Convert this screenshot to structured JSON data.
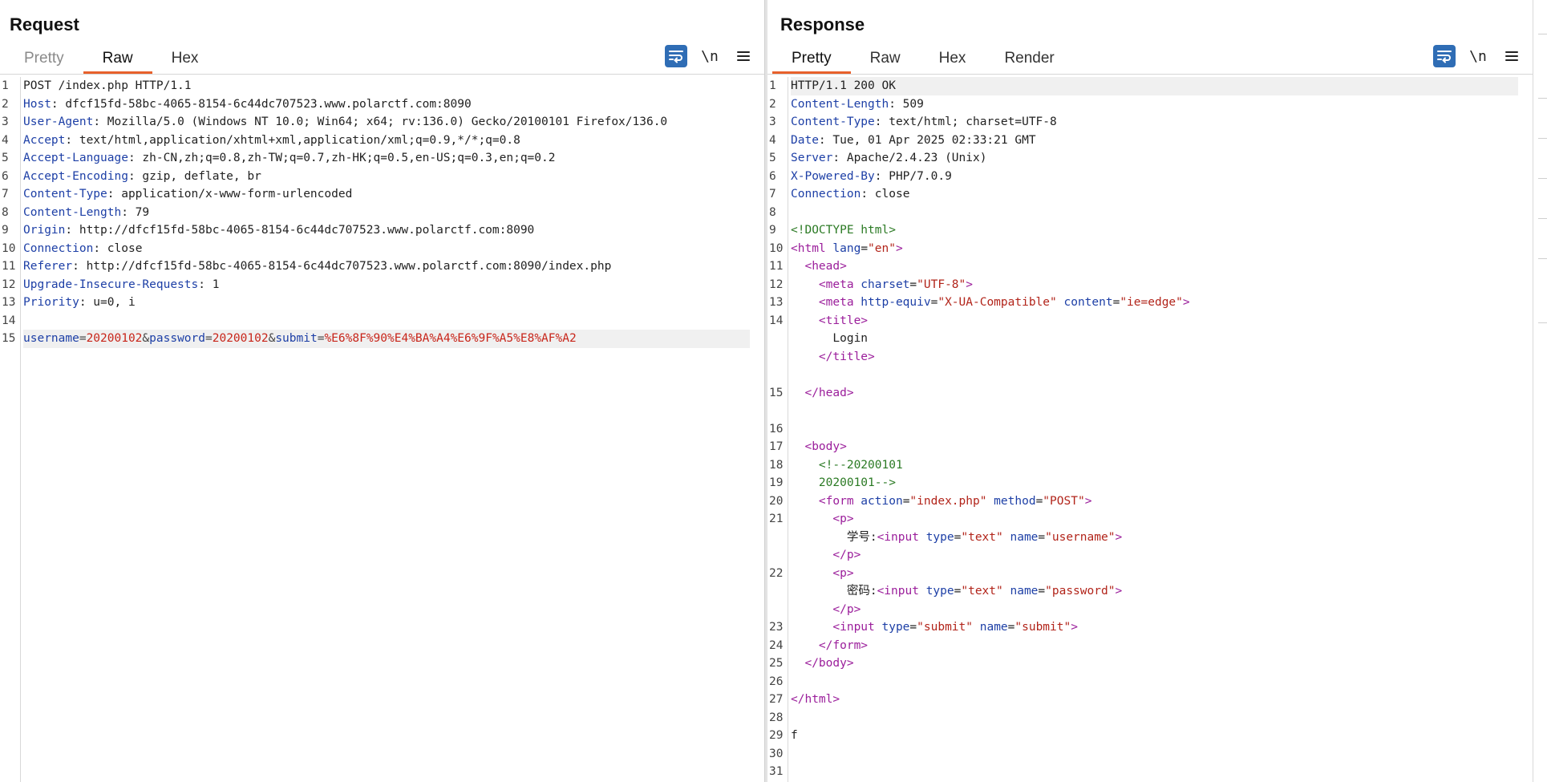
{
  "request": {
    "title": "Request",
    "tabs": [
      "Pretty",
      "Raw",
      "Hex"
    ],
    "active_tab": "Raw",
    "lines": [
      {
        "n": "1",
        "segs": [
          {
            "t": "POST /index.php HTTP/1.1",
            "c": "v"
          }
        ]
      },
      {
        "n": "2",
        "segs": [
          {
            "t": "Host",
            "c": "k"
          },
          {
            "t": ": dfcf15fd-58bc-4065-8154-6c44dc707523.www.polarctf.com:8090",
            "c": "v"
          }
        ]
      },
      {
        "n": "3",
        "segs": [
          {
            "t": "User-Agent",
            "c": "k"
          },
          {
            "t": ": Mozilla/5.0 (Windows NT 10.0; Win64; x64; rv:136.0) Gecko/20100101 Firefox/136.0",
            "c": "v"
          }
        ]
      },
      {
        "n": "4",
        "segs": [
          {
            "t": "Accept",
            "c": "k"
          },
          {
            "t": ": text/html,application/xhtml+xml,application/xml;q=0.9,*/*;q=0.8",
            "c": "v"
          }
        ]
      },
      {
        "n": "5",
        "segs": [
          {
            "t": "Accept-Language",
            "c": "k"
          },
          {
            "t": ": zh-CN,zh;q=0.8,zh-TW;q=0.7,zh-HK;q=0.5,en-US;q=0.3,en;q=0.2",
            "c": "v"
          }
        ]
      },
      {
        "n": "6",
        "segs": [
          {
            "t": "Accept-Encoding",
            "c": "k"
          },
          {
            "t": ": gzip, deflate, br",
            "c": "v"
          }
        ]
      },
      {
        "n": "7",
        "segs": [
          {
            "t": "Content-Type",
            "c": "k"
          },
          {
            "t": ": application/x-www-form-urlencoded",
            "c": "v"
          }
        ]
      },
      {
        "n": "8",
        "segs": [
          {
            "t": "Content-Length",
            "c": "k"
          },
          {
            "t": ": 79",
            "c": "v"
          }
        ]
      },
      {
        "n": "9",
        "segs": [
          {
            "t": "Origin",
            "c": "k"
          },
          {
            "t": ": http://dfcf15fd-58bc-4065-8154-6c44dc707523.www.polarctf.com:8090",
            "c": "v"
          }
        ]
      },
      {
        "n": "10",
        "segs": [
          {
            "t": "Connection",
            "c": "k"
          },
          {
            "t": ": close",
            "c": "v"
          }
        ]
      },
      {
        "n": "11",
        "segs": [
          {
            "t": "Referer",
            "c": "k"
          },
          {
            "t": ": http://dfcf15fd-58bc-4065-8154-6c44dc707523.www.polarctf.com:8090/index.php",
            "c": "v"
          }
        ]
      },
      {
        "n": "12",
        "segs": [
          {
            "t": "Upgrade-Insecure-Requests",
            "c": "k"
          },
          {
            "t": ": 1",
            "c": "v"
          }
        ]
      },
      {
        "n": "13",
        "segs": [
          {
            "t": "Priority",
            "c": "k"
          },
          {
            "t": ": u=0, i",
            "c": "v"
          }
        ]
      },
      {
        "n": "14",
        "segs": []
      },
      {
        "n": "15",
        "hl": true,
        "segs": [
          {
            "t": "username",
            "c": "param"
          },
          {
            "t": "=",
            "c": "sep"
          },
          {
            "t": "20200102",
            "c": "pval"
          },
          {
            "t": "&",
            "c": "sep"
          },
          {
            "t": "password",
            "c": "param"
          },
          {
            "t": "=",
            "c": "sep"
          },
          {
            "t": "20200102",
            "c": "pval"
          },
          {
            "t": "&",
            "c": "sep"
          },
          {
            "t": "submit",
            "c": "param"
          },
          {
            "t": "=",
            "c": "sep"
          },
          {
            "t": "%E6%8F%90%E4%BA%A4%E6%9F%A5%E8%AF%A2",
            "c": "pval"
          }
        ]
      }
    ]
  },
  "response": {
    "title": "Response",
    "tabs": [
      "Pretty",
      "Raw",
      "Hex",
      "Render"
    ],
    "active_tab": "Pretty",
    "lines": [
      {
        "n": "1",
        "hl": true,
        "segs": [
          {
            "t": "HTTP/1.1 200 OK",
            "c": "v"
          }
        ]
      },
      {
        "n": "2",
        "segs": [
          {
            "t": "Content-Length",
            "c": "k"
          },
          {
            "t": ": 509",
            "c": "v"
          }
        ]
      },
      {
        "n": "3",
        "segs": [
          {
            "t": "Content-Type",
            "c": "k"
          },
          {
            "t": ": text/html; charset=UTF-8",
            "c": "v"
          }
        ]
      },
      {
        "n": "4",
        "segs": [
          {
            "t": "Date",
            "c": "k"
          },
          {
            "t": ": Tue, 01 Apr 2025 02:33:21 GMT",
            "c": "v"
          }
        ]
      },
      {
        "n": "5",
        "segs": [
          {
            "t": "Server",
            "c": "k"
          },
          {
            "t": ": Apache/2.4.23 (Unix)",
            "c": "v"
          }
        ]
      },
      {
        "n": "6",
        "segs": [
          {
            "t": "X-Powered-By",
            "c": "k"
          },
          {
            "t": ": PHP/7.0.9",
            "c": "v"
          }
        ]
      },
      {
        "n": "7",
        "segs": [
          {
            "t": "Connection",
            "c": "k"
          },
          {
            "t": ": close",
            "c": "v"
          }
        ]
      },
      {
        "n": "8",
        "segs": []
      },
      {
        "n": "9",
        "segs": [
          {
            "t": "<!DOCTYPE html>",
            "c": "cmt"
          }
        ]
      },
      {
        "n": "10",
        "segs": [
          {
            "t": "<",
            "c": "tag"
          },
          {
            "t": "html",
            "c": "tag"
          },
          {
            "t": " lang",
            "c": "attr"
          },
          {
            "t": "=",
            "c": "v"
          },
          {
            "t": "\"en\"",
            "c": "str"
          },
          {
            "t": ">",
            "c": "tag"
          }
        ]
      },
      {
        "n": "11",
        "segs": [
          {
            "t": "  <head>",
            "c": "tag"
          }
        ]
      },
      {
        "n": "12",
        "segs": [
          {
            "t": "    <meta",
            "c": "tag"
          },
          {
            "t": " charset",
            "c": "attr"
          },
          {
            "t": "=",
            "c": "v"
          },
          {
            "t": "\"UTF-8\"",
            "c": "str"
          },
          {
            "t": ">",
            "c": "tag"
          }
        ]
      },
      {
        "n": "13",
        "segs": [
          {
            "t": "    <meta",
            "c": "tag"
          },
          {
            "t": " http-equiv",
            "c": "attr"
          },
          {
            "t": "=",
            "c": "v"
          },
          {
            "t": "\"X-UA-Compatible\"",
            "c": "str"
          },
          {
            "t": " content",
            "c": "attr"
          },
          {
            "t": "=",
            "c": "v"
          },
          {
            "t": "\"ie=edge\"",
            "c": "str"
          },
          {
            "t": ">",
            "c": "tag"
          }
        ]
      },
      {
        "n": "14",
        "segs": [
          {
            "t": "    <title>",
            "c": "tag"
          }
        ]
      },
      {
        "n": "",
        "segs": [
          {
            "t": "      Login",
            "c": "v"
          }
        ]
      },
      {
        "n": "",
        "segs": [
          {
            "t": "    </title>",
            "c": "tag"
          }
        ]
      },
      {
        "n": "",
        "segs": []
      },
      {
        "n": "15",
        "segs": [
          {
            "t": "  </head>",
            "c": "tag"
          }
        ]
      },
      {
        "n": "",
        "segs": []
      },
      {
        "n": "16",
        "segs": []
      },
      {
        "n": "17",
        "segs": [
          {
            "t": "  <body>",
            "c": "tag"
          }
        ]
      },
      {
        "n": "18",
        "segs": [
          {
            "t": "    <!--20200101",
            "c": "cmt"
          }
        ]
      },
      {
        "n": "19",
        "segs": [
          {
            "t": "    20200101-->",
            "c": "cmt"
          }
        ]
      },
      {
        "n": "20",
        "segs": [
          {
            "t": "    <form",
            "c": "tag"
          },
          {
            "t": " action",
            "c": "attr"
          },
          {
            "t": "=",
            "c": "v"
          },
          {
            "t": "\"index.php\"",
            "c": "str"
          },
          {
            "t": " method",
            "c": "attr"
          },
          {
            "t": "=",
            "c": "v"
          },
          {
            "t": "\"POST\"",
            "c": "str"
          },
          {
            "t": ">",
            "c": "tag"
          }
        ]
      },
      {
        "n": "21",
        "segs": [
          {
            "t": "      <p>",
            "c": "tag"
          }
        ]
      },
      {
        "n": "",
        "segs": [
          {
            "t": "        学号:",
            "c": "v"
          },
          {
            "t": "<input",
            "c": "tag"
          },
          {
            "t": " type",
            "c": "attr"
          },
          {
            "t": "=",
            "c": "v"
          },
          {
            "t": "\"text\"",
            "c": "str"
          },
          {
            "t": " name",
            "c": "attr"
          },
          {
            "t": "=",
            "c": "v"
          },
          {
            "t": "\"username\"",
            "c": "str"
          },
          {
            "t": ">",
            "c": "tag"
          }
        ]
      },
      {
        "n": "",
        "segs": [
          {
            "t": "      </p>",
            "c": "tag"
          }
        ]
      },
      {
        "n": "22",
        "segs": [
          {
            "t": "      <p>",
            "c": "tag"
          }
        ]
      },
      {
        "n": "",
        "segs": [
          {
            "t": "        密码:",
            "c": "v"
          },
          {
            "t": "<input",
            "c": "tag"
          },
          {
            "t": " type",
            "c": "attr"
          },
          {
            "t": "=",
            "c": "v"
          },
          {
            "t": "\"text\"",
            "c": "str"
          },
          {
            "t": " name",
            "c": "attr"
          },
          {
            "t": "=",
            "c": "v"
          },
          {
            "t": "\"password\"",
            "c": "str"
          },
          {
            "t": ">",
            "c": "tag"
          }
        ]
      },
      {
        "n": "",
        "segs": [
          {
            "t": "      </p>",
            "c": "tag"
          }
        ]
      },
      {
        "n": "23",
        "segs": [
          {
            "t": "      <input",
            "c": "tag"
          },
          {
            "t": " type",
            "c": "attr"
          },
          {
            "t": "=",
            "c": "v"
          },
          {
            "t": "\"submit\"",
            "c": "str"
          },
          {
            "t": " name",
            "c": "attr"
          },
          {
            "t": "=",
            "c": "v"
          },
          {
            "t": "\"submit\"",
            "c": "str"
          },
          {
            "t": ">",
            "c": "tag"
          }
        ]
      },
      {
        "n": "24",
        "segs": [
          {
            "t": "    </form>",
            "c": "tag"
          }
        ]
      },
      {
        "n": "25",
        "segs": [
          {
            "t": "  </body>",
            "c": "tag"
          }
        ]
      },
      {
        "n": "26",
        "segs": []
      },
      {
        "n": "27",
        "segs": [
          {
            "t": "</html>",
            "c": "tag"
          }
        ]
      },
      {
        "n": "28",
        "segs": []
      },
      {
        "n": "29",
        "segs": [
          {
            "t": "f",
            "c": "v"
          }
        ]
      },
      {
        "n": "30",
        "segs": []
      },
      {
        "n": "31",
        "segs": []
      }
    ]
  },
  "toolbar": {
    "wrap_icon": "text-wrap-icon",
    "newline_label": "\\n",
    "menu_icon": "hamburger-menu-icon"
  },
  "layout_toggles": [
    {
      "icon": "split-horizontal-icon",
      "active": true
    },
    {
      "icon": "split-vertical-icon",
      "active": false
    },
    {
      "icon": "single-pane-icon",
      "active": false
    }
  ],
  "colors": {
    "accent": "#e8612c",
    "button_blue": "#2f6db5",
    "header_name": "#1d3fa6",
    "tag": "#9b1e9b",
    "string": "#b2241a",
    "comment": "#2b7a24"
  }
}
